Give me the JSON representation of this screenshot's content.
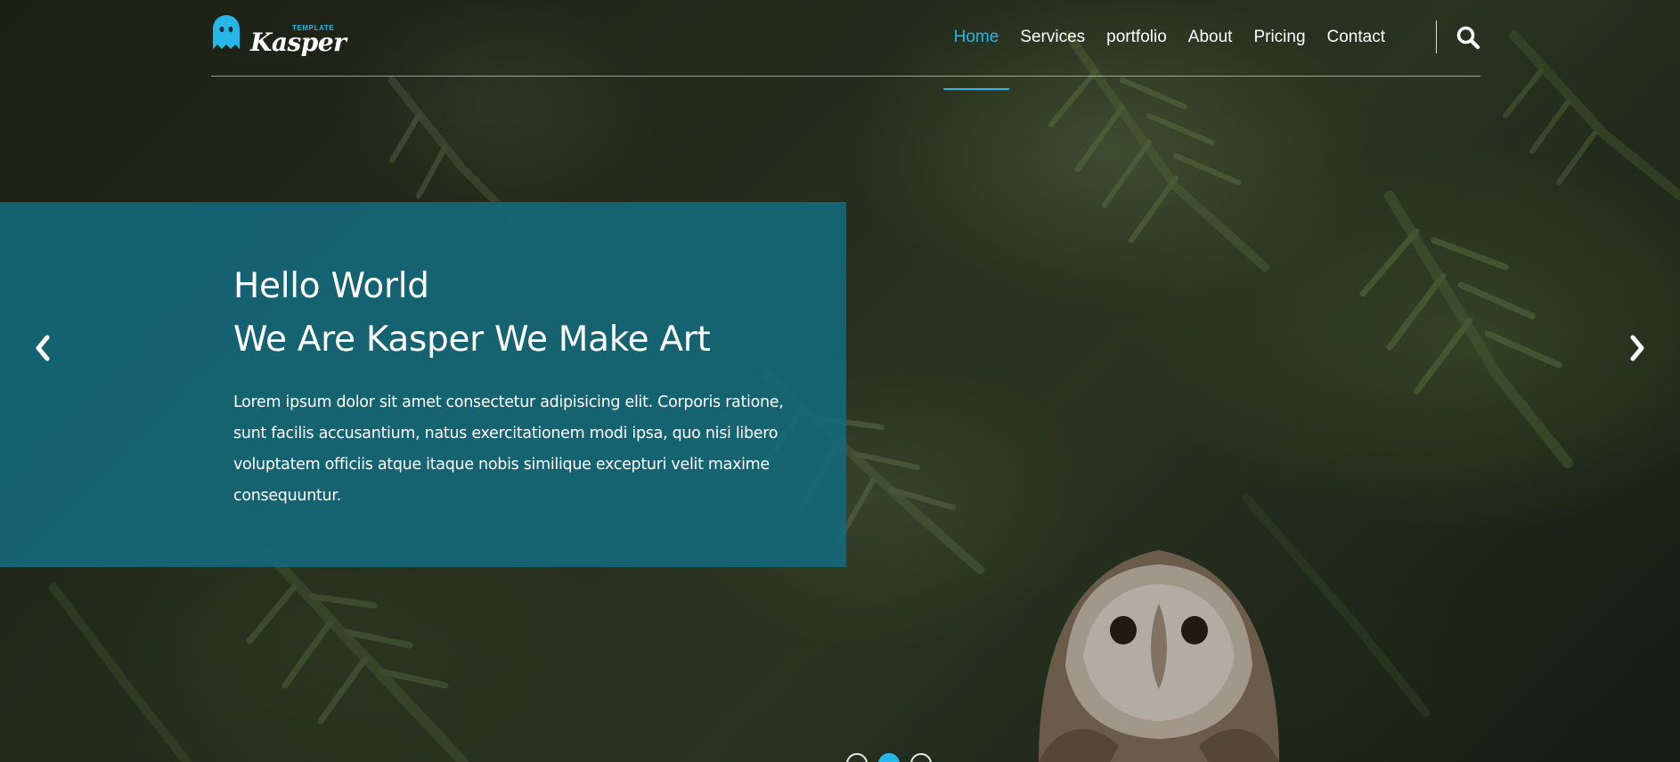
{
  "logo": {
    "tag": "TEMPLATE",
    "word": "Kasper",
    "icon": "ghost-icon"
  },
  "nav": {
    "items": [
      {
        "label": "Home",
        "active": true
      },
      {
        "label": "Services",
        "active": false
      },
      {
        "label": "portfolio",
        "active": false
      },
      {
        "label": "About",
        "active": false
      },
      {
        "label": "Pricing",
        "active": false
      },
      {
        "label": "Contact",
        "active": false
      }
    ],
    "search_icon": "search-icon"
  },
  "slide": {
    "title_line_1": "Hello World",
    "title_line_2": "We Are Kasper We Make Art",
    "text": "Lorem ipsum dolor sit amet consectetur adipisicing elit. Corporis ratione, sunt facilis accusantium, natus exercitationem modi ipsa, quo nisi libero voluptatem officiis atque itaque nobis similique excepturi velit maxime consequuntur.",
    "prev_icon": "chevron-left-icon",
    "next_icon": "chevron-right-icon"
  },
  "bullets": {
    "count": 3,
    "active_index": 1
  },
  "colors": {
    "accent": "#25b7e8",
    "slide_box": "#136a7d",
    "text": "#ffffff"
  }
}
